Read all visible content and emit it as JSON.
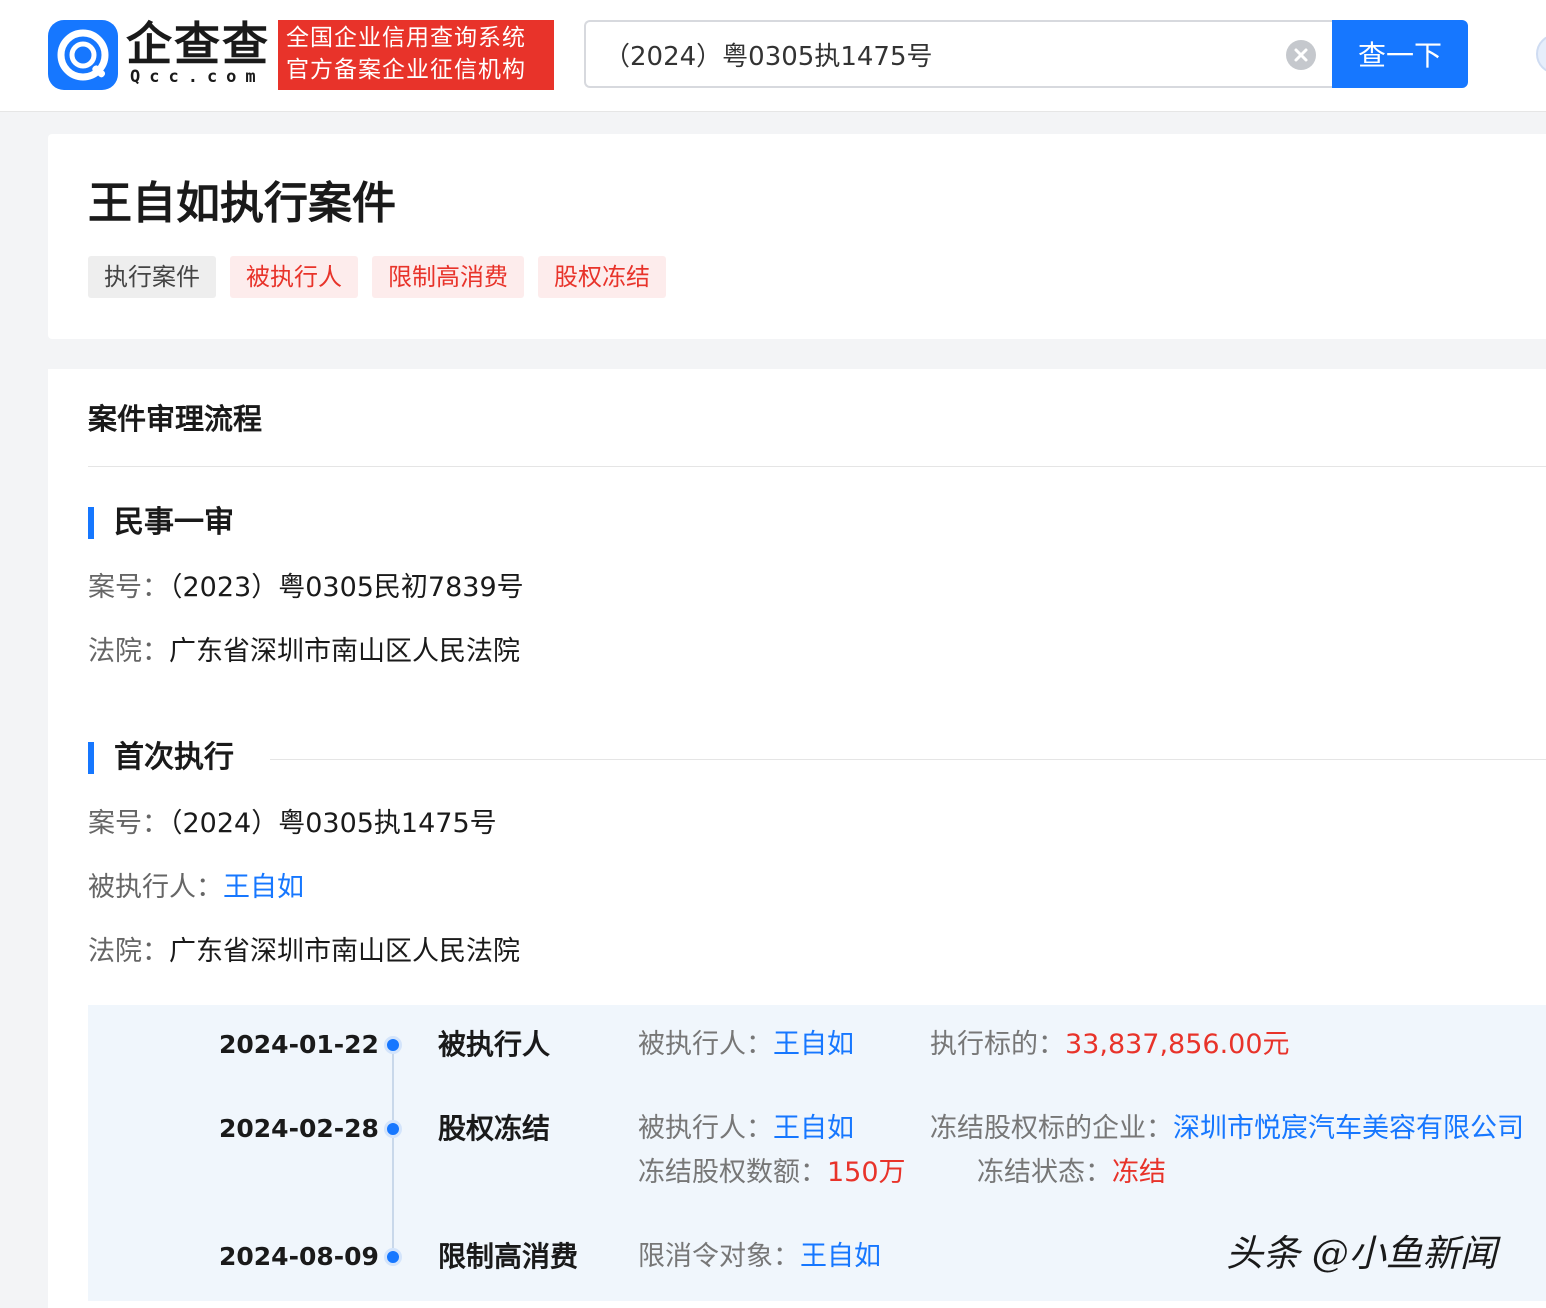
{
  "header": {
    "logo_cn": "企查查",
    "logo_en": "Qcc.com",
    "cert_line1": "全国企业信用查询系统",
    "cert_line2": "官方备案企业征信机构",
    "search_value": "（2024）粤0305执1475号",
    "search_button": "查一下"
  },
  "title_card": {
    "title": "王自如执行案件",
    "tags": [
      "执行案件",
      "被执行人",
      "限制高消费",
      "股权冻结"
    ]
  },
  "process": {
    "section_title": "案件审理流程",
    "first_instance": {
      "name": "民事一审",
      "case_label": "案号：",
      "case_no": "（2023）粤0305民初7839号",
      "court_label": "法院：",
      "court": "广东省深圳市南山区人民法院"
    },
    "first_execution": {
      "name": "首次执行",
      "case_label": "案号：",
      "case_no": "（2024）粤0305执1475号",
      "executee_label": "被执行人：",
      "executee": "王自如",
      "court_label": "法院：",
      "court": "广东省深圳市南山区人民法院"
    },
    "timeline": [
      {
        "date": "2024-01-22",
        "type": "被执行人",
        "executee_label": "被执行人：",
        "executee": "王自如",
        "amount_label": "执行标的：",
        "amount": "33,837,856.00元"
      },
      {
        "date": "2024-02-28",
        "type": "股权冻结",
        "executee_label": "被执行人：",
        "executee": "王自如",
        "company_label": "冻结股权标的企业：",
        "company": "深圳市悦宸汽车美容有限公司",
        "share_label": "冻结股权数额：",
        "share": "150万",
        "status_label": "冻结状态：",
        "status": "冻结"
      },
      {
        "date": "2024-08-09",
        "type": "限制高消费",
        "target_label": "限消令对象：",
        "target": "王自如"
      }
    ]
  },
  "watermark": "头条 @小鱼新闻",
  "colors": {
    "brand_blue": "#1677ff",
    "cert_red": "#e8332a",
    "tag_red_bg": "#fdecec",
    "timeline_bg": "#f0f6fc"
  }
}
